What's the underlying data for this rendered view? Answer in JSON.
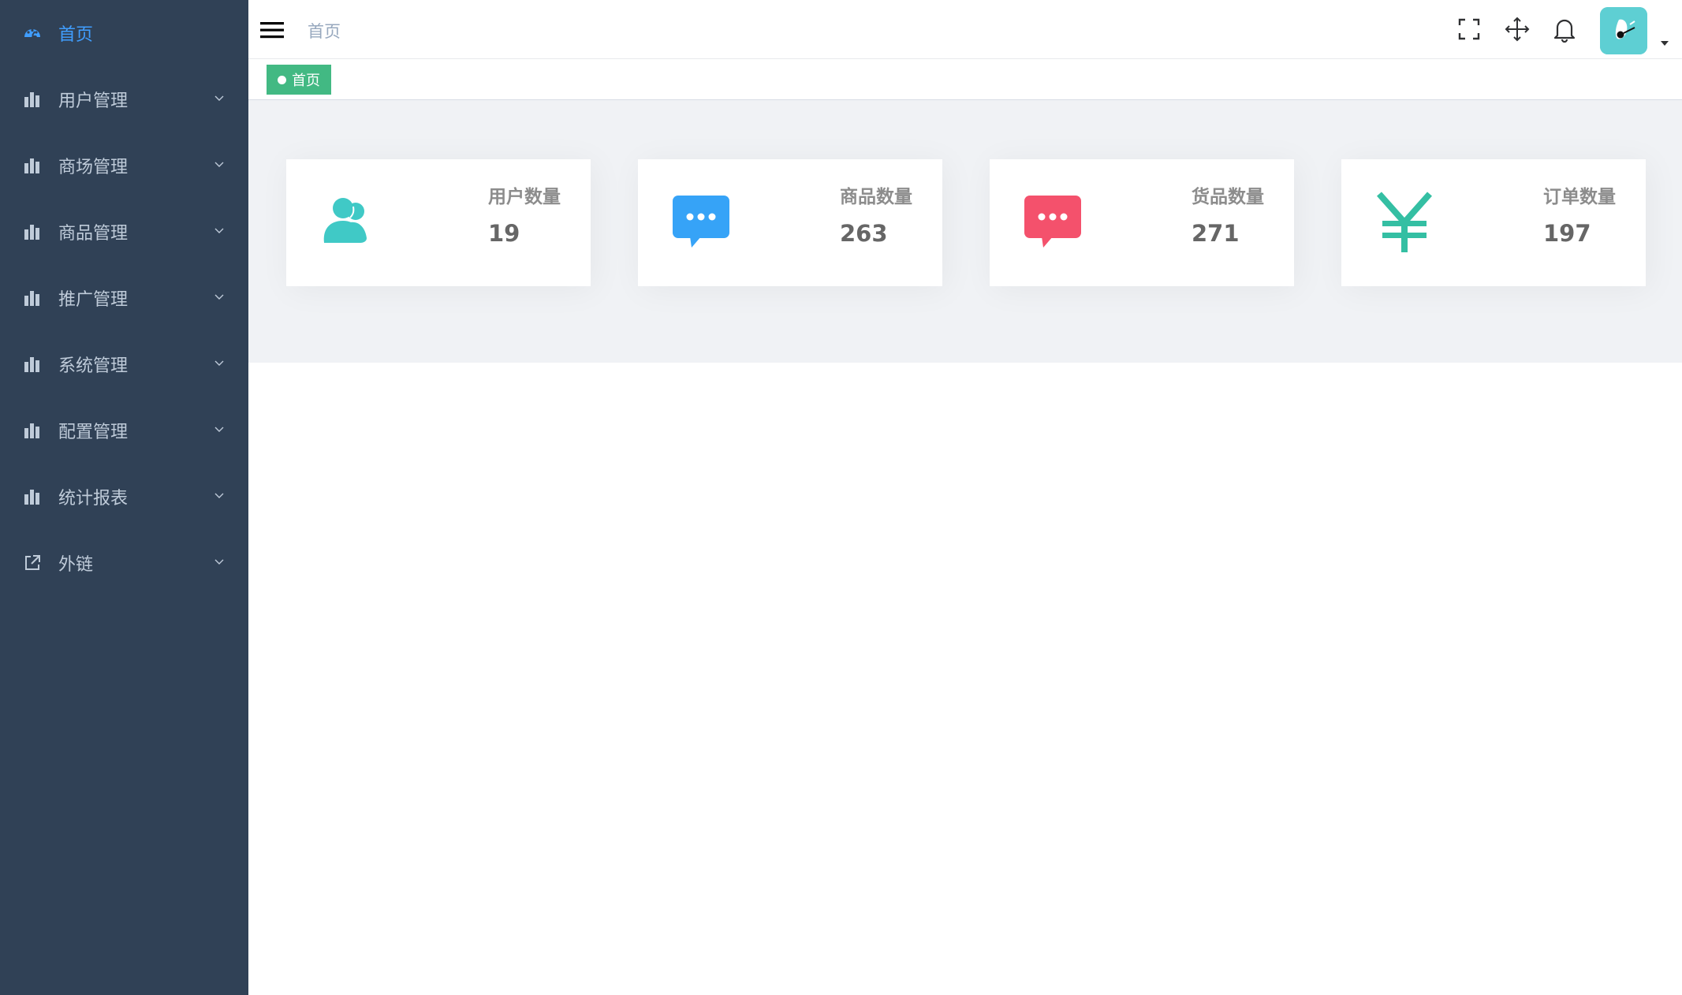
{
  "sidebar": {
    "background": "#304156",
    "active_color": "#409eff",
    "items": [
      {
        "label": "首页",
        "icon": "dashboard-icon",
        "active": true,
        "expandable": false
      },
      {
        "label": "用户管理",
        "icon": "bar-chart-icon",
        "active": false,
        "expandable": true
      },
      {
        "label": "商场管理",
        "icon": "bar-chart-icon",
        "active": false,
        "expandable": true
      },
      {
        "label": "商品管理",
        "icon": "bar-chart-icon",
        "active": false,
        "expandable": true
      },
      {
        "label": "推广管理",
        "icon": "bar-chart-icon",
        "active": false,
        "expandable": true
      },
      {
        "label": "系统管理",
        "icon": "bar-chart-icon",
        "active": false,
        "expandable": true
      },
      {
        "label": "配置管理",
        "icon": "bar-chart-icon",
        "active": false,
        "expandable": true
      },
      {
        "label": "统计报表",
        "icon": "bar-chart-icon",
        "active": false,
        "expandable": true
      },
      {
        "label": "外链",
        "icon": "external-link-icon",
        "active": false,
        "expandable": true
      }
    ]
  },
  "navbar": {
    "breadcrumb": "首页",
    "icons": [
      "fullscreen-icon",
      "move-icon",
      "bell-icon"
    ],
    "avatar_color": "#5ecfd3"
  },
  "tags_view": {
    "tags": [
      {
        "label": "首页",
        "active": true,
        "color": "#42b983"
      }
    ]
  },
  "dashboard": {
    "background": "#f0f2f5",
    "cards": [
      {
        "label": "用户数量",
        "value": "19",
        "icon": "users-icon",
        "color": "#40c9c6"
      },
      {
        "label": "商品数量",
        "value": "263",
        "icon": "message-icon",
        "color": "#36a3f7"
      },
      {
        "label": "货品数量",
        "value": "271",
        "icon": "message-icon",
        "color": "#f4516c"
      },
      {
        "label": "订单数量",
        "value": "197",
        "icon": "yen-icon",
        "color": "#34bfa3"
      }
    ]
  }
}
